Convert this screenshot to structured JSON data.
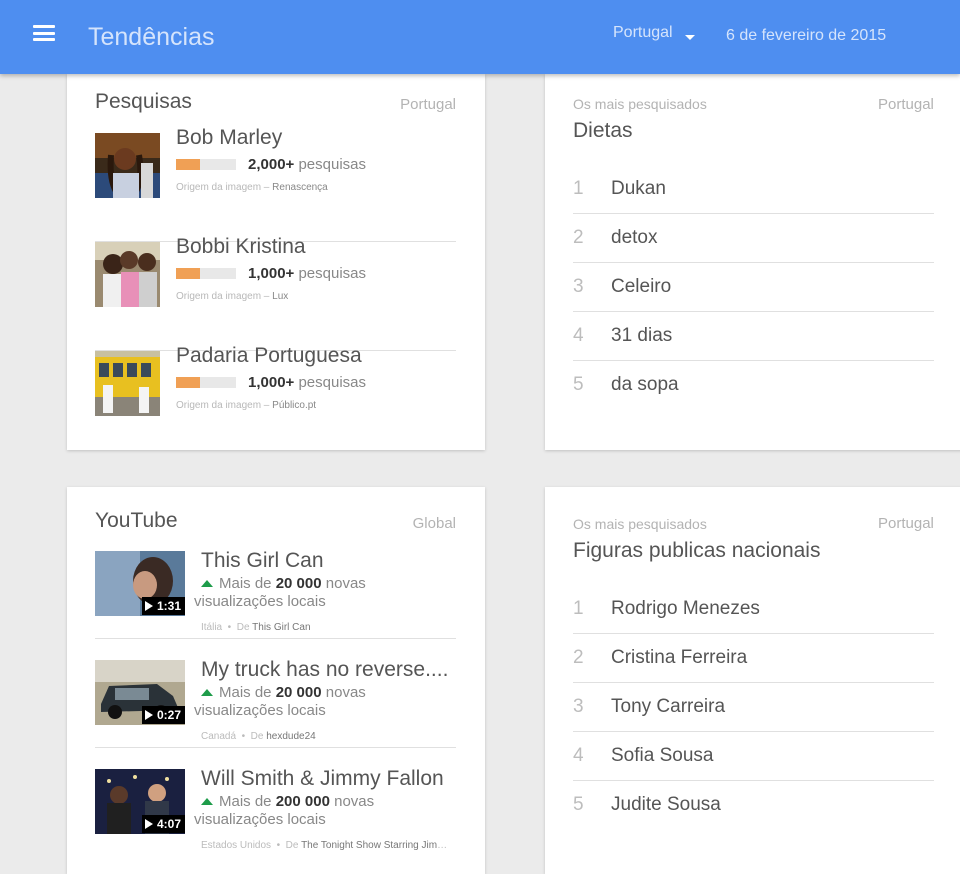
{
  "appbar": {
    "title": "Tendências",
    "region": "Portugal",
    "date": "6 de fevereiro de 2015"
  },
  "searches_card": {
    "title": "Pesquisas",
    "scope": "Portugal",
    "source_prefix": "Origem da imagem –",
    "unit": "pesquisas",
    "items": [
      {
        "name": "Bob Marley",
        "count": "2,000+",
        "source": "Renascença",
        "bar_fraction": 0.4
      },
      {
        "name": "Bobbi Kristina",
        "count": "1,000+",
        "source": "Lux",
        "bar_fraction": 0.4
      },
      {
        "name": "Padaria Portuguesa",
        "count": "1,000+",
        "source": "Público.pt",
        "bar_fraction": 0.4
      }
    ]
  },
  "diets_card": {
    "eyebrow": "Os mais pesquisados",
    "scope": "Portugal",
    "title": "Dietas",
    "items": [
      {
        "rank": "1",
        "label": "Dukan"
      },
      {
        "rank": "2",
        "label": "detox"
      },
      {
        "rank": "3",
        "label": "Celeiro"
      },
      {
        "rank": "4",
        "label": "31 dias"
      },
      {
        "rank": "5",
        "label": "da sopa"
      }
    ]
  },
  "youtube_card": {
    "title": "YouTube",
    "scope": "Global",
    "views_prefix": "Mais de",
    "views_suffix": "novas visualizações locais",
    "by_prefix": "De",
    "items": [
      {
        "title": "This Girl Can",
        "duration": "1:31",
        "views": "20 000",
        "country": "Itália",
        "channel": "This Girl Can"
      },
      {
        "title": "My truck has no reverse....",
        "duration": "0:27",
        "views": "20 000",
        "country": "Canadá",
        "channel": "hexdude24"
      },
      {
        "title": "Will Smith & Jimmy Fallon",
        "duration": "4:07",
        "views": "200 000",
        "country": "Estados Unidos",
        "channel": "The Tonight Show Starring Jimmy Fallon"
      }
    ]
  },
  "figures_card": {
    "eyebrow": "Os mais pesquisados",
    "scope": "Portugal",
    "title": "Figuras publicas nacionais",
    "items": [
      {
        "rank": "1",
        "label": "Rodrigo Menezes"
      },
      {
        "rank": "2",
        "label": "Cristina Ferreira"
      },
      {
        "rank": "3",
        "label": "Tony Carreira"
      },
      {
        "rank": "4",
        "label": "Sofia Sousa"
      },
      {
        "rank": "5",
        "label": "Judite Sousa"
      }
    ]
  },
  "colors": {
    "appbar": "#4e8ef0",
    "bar_fill": "#f0a055",
    "trend_up": "#1e9c4a"
  }
}
